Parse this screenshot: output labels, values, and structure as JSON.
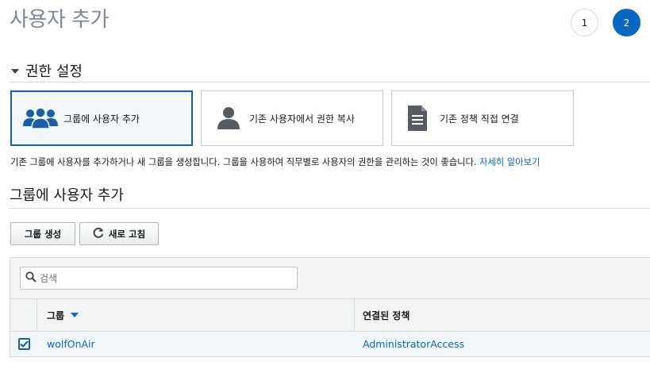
{
  "header": {
    "title": "사용자 추가",
    "steps": [
      "1",
      "2"
    ],
    "active_step": "2"
  },
  "permissions": {
    "section_title": "권한 설정",
    "options": [
      {
        "label": "그룹에 사용자 추가",
        "icon": "users-group-icon",
        "selected": true
      },
      {
        "label": "기존 사용자에서 권한 복사",
        "icon": "user-icon",
        "selected": false
      },
      {
        "label": "기존 정책 직접 연결",
        "icon": "document-icon",
        "selected": false
      }
    ],
    "description": "기존 그룹에 사용자를 추가하거나 새 그룹을 생성합니다. 그룹을 사용하여 직무별로 사용자의 권한을 관리하는 것이 좋습니다.",
    "learn_more": "자세히 알아보기"
  },
  "group_section": {
    "title": "그룹에 사용자 추가",
    "create_button": "그룹 생성",
    "refresh_button": "새로 고침",
    "search": {
      "placeholder": "검색",
      "value": ""
    },
    "columns": [
      "그룹",
      "연결된 정책"
    ],
    "rows": [
      {
        "group": "wolfOnAir",
        "policy": "AdministratorAccess",
        "checked": true
      }
    ]
  },
  "colors": {
    "accent": "#0a67c1",
    "selected_border": "#1b5ea8",
    "selected_bg": "#f1f6fb"
  }
}
